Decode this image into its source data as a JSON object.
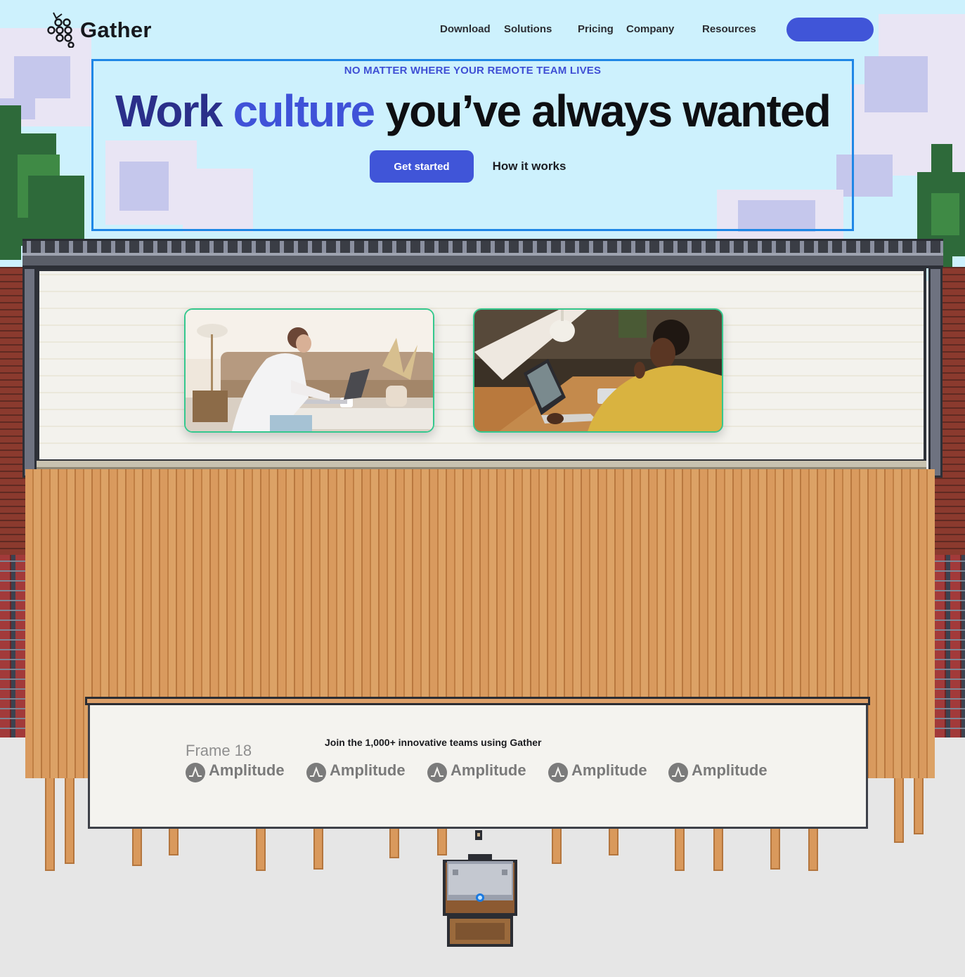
{
  "brand": {
    "name": "Gather"
  },
  "nav": {
    "links": [
      {
        "label": "Download"
      },
      {
        "label": "Solutions"
      },
      {
        "label": "Pricing"
      },
      {
        "label": "Company"
      },
      {
        "label": "Resources"
      }
    ],
    "cta_label": ""
  },
  "hero": {
    "eyebrow": "NO MATTER WHERE YOUR REMOTE TEAM LIVES",
    "headline_part1": "Work ",
    "headline_part2": "culture",
    "headline_part3": " you’ve always wanted",
    "primary_button": "Get started",
    "secondary_button": "How it works"
  },
  "logos": {
    "frame_label": "Frame 18",
    "heading": "Join the 1,000+ innovative teams using Gather",
    "items": [
      {
        "name": "Amplitude"
      },
      {
        "name": "Amplitude"
      },
      {
        "name": "Amplitude"
      },
      {
        "name": "Amplitude"
      },
      {
        "name": "Amplitude"
      }
    ]
  },
  "colors": {
    "accent": "#4055d8",
    "sky": "#cdf1fd",
    "hero_border": "#1f87e6",
    "photo_border": "#34c88e"
  }
}
